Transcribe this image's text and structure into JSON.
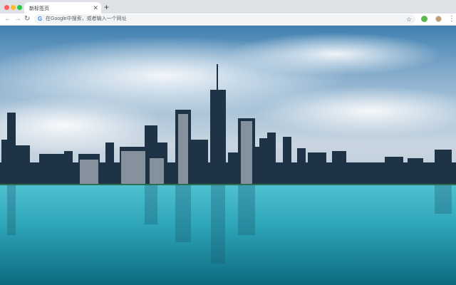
{
  "browser": {
    "tab": {
      "title": "新标签页",
      "close_icon": "close-icon"
    },
    "new_tab_icon": "plus-icon",
    "traffic_lights": [
      "#ff5f57",
      "#febc2e",
      "#28c840"
    ],
    "nav_icons": [
      "back-icon",
      "forward-icon",
      "reload-icon"
    ],
    "omnibox": {
      "placeholder": "在Google中搜索，或者输入一个网址",
      "icon": "google-icon"
    },
    "bookmark_icon": "star-icon",
    "extension_color": "#5fb94f",
    "menu_icon": "kebab-menu-icon"
  },
  "wallpaper": {
    "subject": "city skyline over water",
    "colors": {
      "sky_top": "#3f7fb0",
      "sky_mid": "#a7c2d8",
      "water_top": "#3fb7c8",
      "water_bottom": "#0e6f82"
    }
  }
}
